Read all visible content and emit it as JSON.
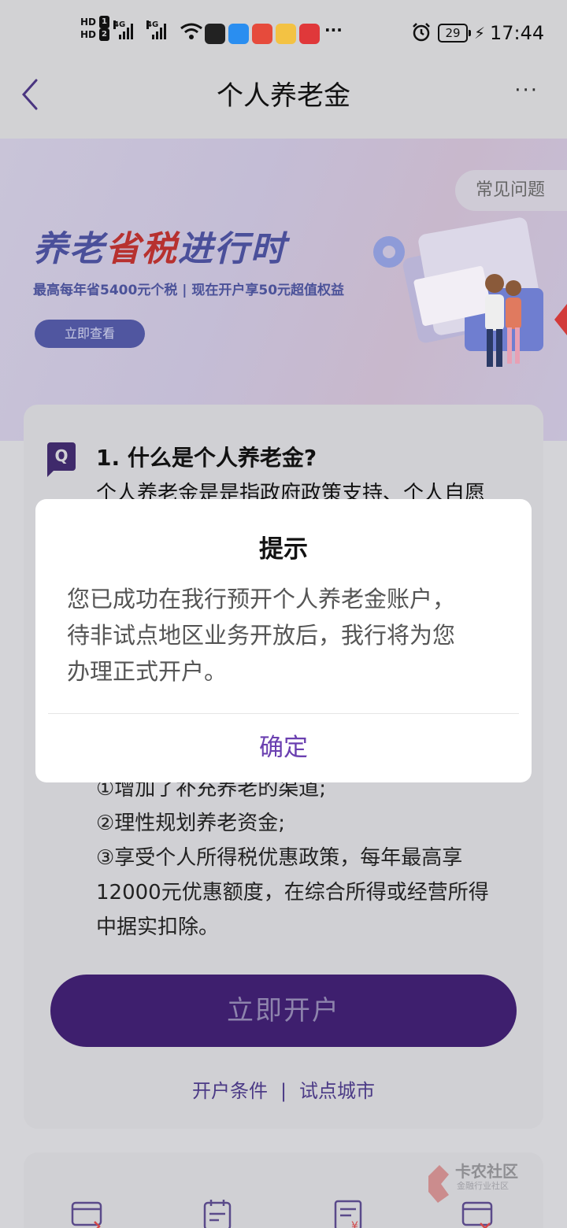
{
  "status_bar": {
    "hd1": "HD",
    "hd1_num": "1",
    "hd2": "HD",
    "hd2_num": "2",
    "net1": "4G",
    "net2": "4G",
    "more": "···",
    "battery": "29",
    "time": "17:44"
  },
  "header": {
    "title": "个人养老金",
    "more": "···"
  },
  "banner": {
    "faq": "常见问题",
    "slogan_a": "养老",
    "slogan_b": "省税",
    "slogan_c": "进行时",
    "subtitle": "最高每年省5400元个税 | 现在开户享50元超值权益",
    "button": "立即查看"
  },
  "qa": {
    "badge": "Q",
    "question": "1. 什么是个人养老金?",
    "answer": "个人养老金是是指政府政策支持、个人自愿",
    "benefits": [
      "①增加了补充养老的渠道;",
      "②理性规划养老资金;",
      "③享受个人所得税优惠政策，每年最高享",
      "12000元优惠额度，在综合所得或经营所得",
      "中据实扣除。"
    ]
  },
  "actions": {
    "open_account": "立即开户",
    "conditions": "开户条件",
    "separator": "|",
    "pilot_cities": "试点城市"
  },
  "watermark": {
    "name": "卡农社区",
    "sub": "金融行业社区"
  },
  "dialog": {
    "title": "提示",
    "lines": [
      "您已成功在我行预开个人养老金账户，",
      "待非试点地区业务开放后，我行将为您",
      "办理正式开户。"
    ],
    "confirm": "确定"
  },
  "colors": {
    "primary_purple": "#3e1f6e",
    "dialog_confirm": "#6a3fb0",
    "banner_highlight": "#b7312f"
  }
}
